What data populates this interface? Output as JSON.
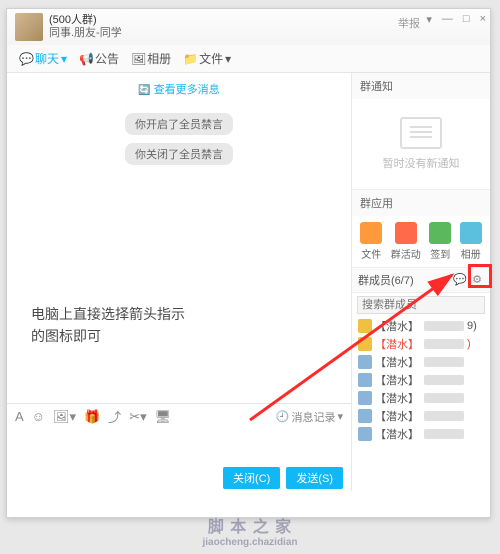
{
  "window": {
    "group_size": "(500人群)",
    "group_name": "同事.朋友-同学",
    "report": "举报",
    "controls": {
      "min": "—",
      "max": "□",
      "close": "×",
      "menu": "▾"
    }
  },
  "toolbar": [
    {
      "label": "聊天",
      "k": "chat"
    },
    {
      "label": "公告",
      "k": "bulletin"
    },
    {
      "label": "相册",
      "k": "album"
    },
    {
      "label": "文件",
      "k": "files"
    }
  ],
  "chat": {
    "more": "查看更多消息",
    "sys": [
      "你开启了全员禁言",
      "你关闭了全员禁言"
    ],
    "overlay_l1": "电脑上直接选择箭头指示",
    "overlay_l2": "的图标即可",
    "record": "消息记录",
    "close_btn": "关闭(C)",
    "send_btn": "发送(S)"
  },
  "side": {
    "notice_title": "群通知",
    "notice_empty": "暂时没有新通知",
    "apps_title": "群应用",
    "apps": [
      {
        "label": "文件"
      },
      {
        "label": "群活动"
      },
      {
        "label": "签到"
      },
      {
        "label": "相册"
      }
    ],
    "members_title": "群成员(6/7)",
    "search_ph": "搜索群成员",
    "members": [
      {
        "tag": "【潜水】",
        "red": false,
        "suffix": "9)"
      },
      {
        "tag": "【潜水】",
        "red": true,
        "suffix": ")"
      },
      {
        "tag": "【潜水】",
        "red": false,
        "suffix": ""
      },
      {
        "tag": "【潜水】",
        "red": false,
        "suffix": ""
      },
      {
        "tag": "【潜水】",
        "red": false,
        "suffix": ""
      },
      {
        "tag": "【潜水】",
        "red": false,
        "suffix": ""
      },
      {
        "tag": "【潜水】",
        "red": false,
        "suffix": ""
      }
    ]
  },
  "watermark": {
    "main": "脚 本 之 家",
    "sub": "jiaocheng.chazidian"
  }
}
